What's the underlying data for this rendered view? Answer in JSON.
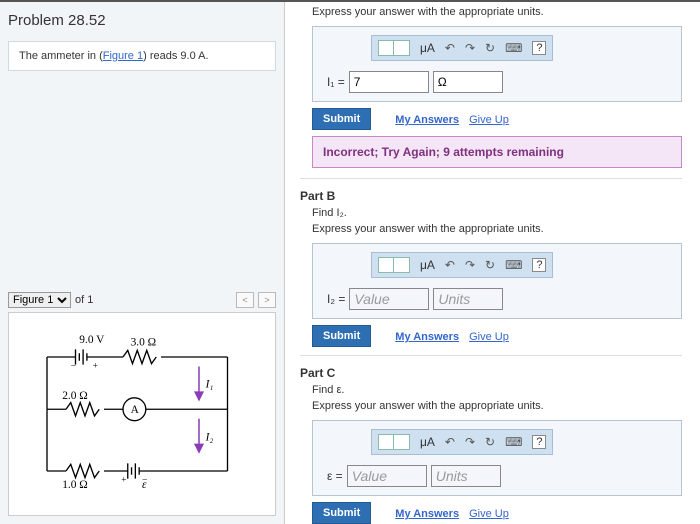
{
  "problem": {
    "title": "Problem 28.52",
    "prompt_pre": "The ammeter in (",
    "prompt_link": "Figure 1",
    "prompt_post": ") reads 9.0 A."
  },
  "figure": {
    "select_label": "Figure 1",
    "of": "of 1",
    "diagram": {
      "top_voltage": "9.0 V",
      "r_top": "3.0 Ω",
      "r_mid": "2.0 Ω",
      "r_bot": "1.0 Ω",
      "ammeter": "A",
      "i1": "I₁",
      "i2": "I₂",
      "emf": "ε"
    }
  },
  "partA": {
    "instruct": "Express your answer with the appropriate units.",
    "var": "I₁ =",
    "val": "7",
    "unit": "Ω",
    "mu": "μA",
    "submit": "Submit",
    "myans": "My Answers",
    "giveup": "Give Up",
    "feedback": "Incorrect; Try Again; 9 attempts remaining"
  },
  "partB": {
    "header": "Part B",
    "find": "Find I₂.",
    "instruct": "Express your answer with the appropriate units.",
    "var": "I₂ =",
    "val_ph": "Value",
    "unit_ph": "Units",
    "mu": "μA",
    "submit": "Submit",
    "myans": "My Answers",
    "giveup": "Give Up"
  },
  "partC": {
    "header": "Part C",
    "find": "Find ε.",
    "instruct": "Express your answer with the appropriate units.",
    "var": "ε =",
    "val_ph": "Value",
    "unit_ph": "Units",
    "mu": "μA",
    "submit": "Submit",
    "myans": "My Answers",
    "giveup": "Give Up"
  }
}
